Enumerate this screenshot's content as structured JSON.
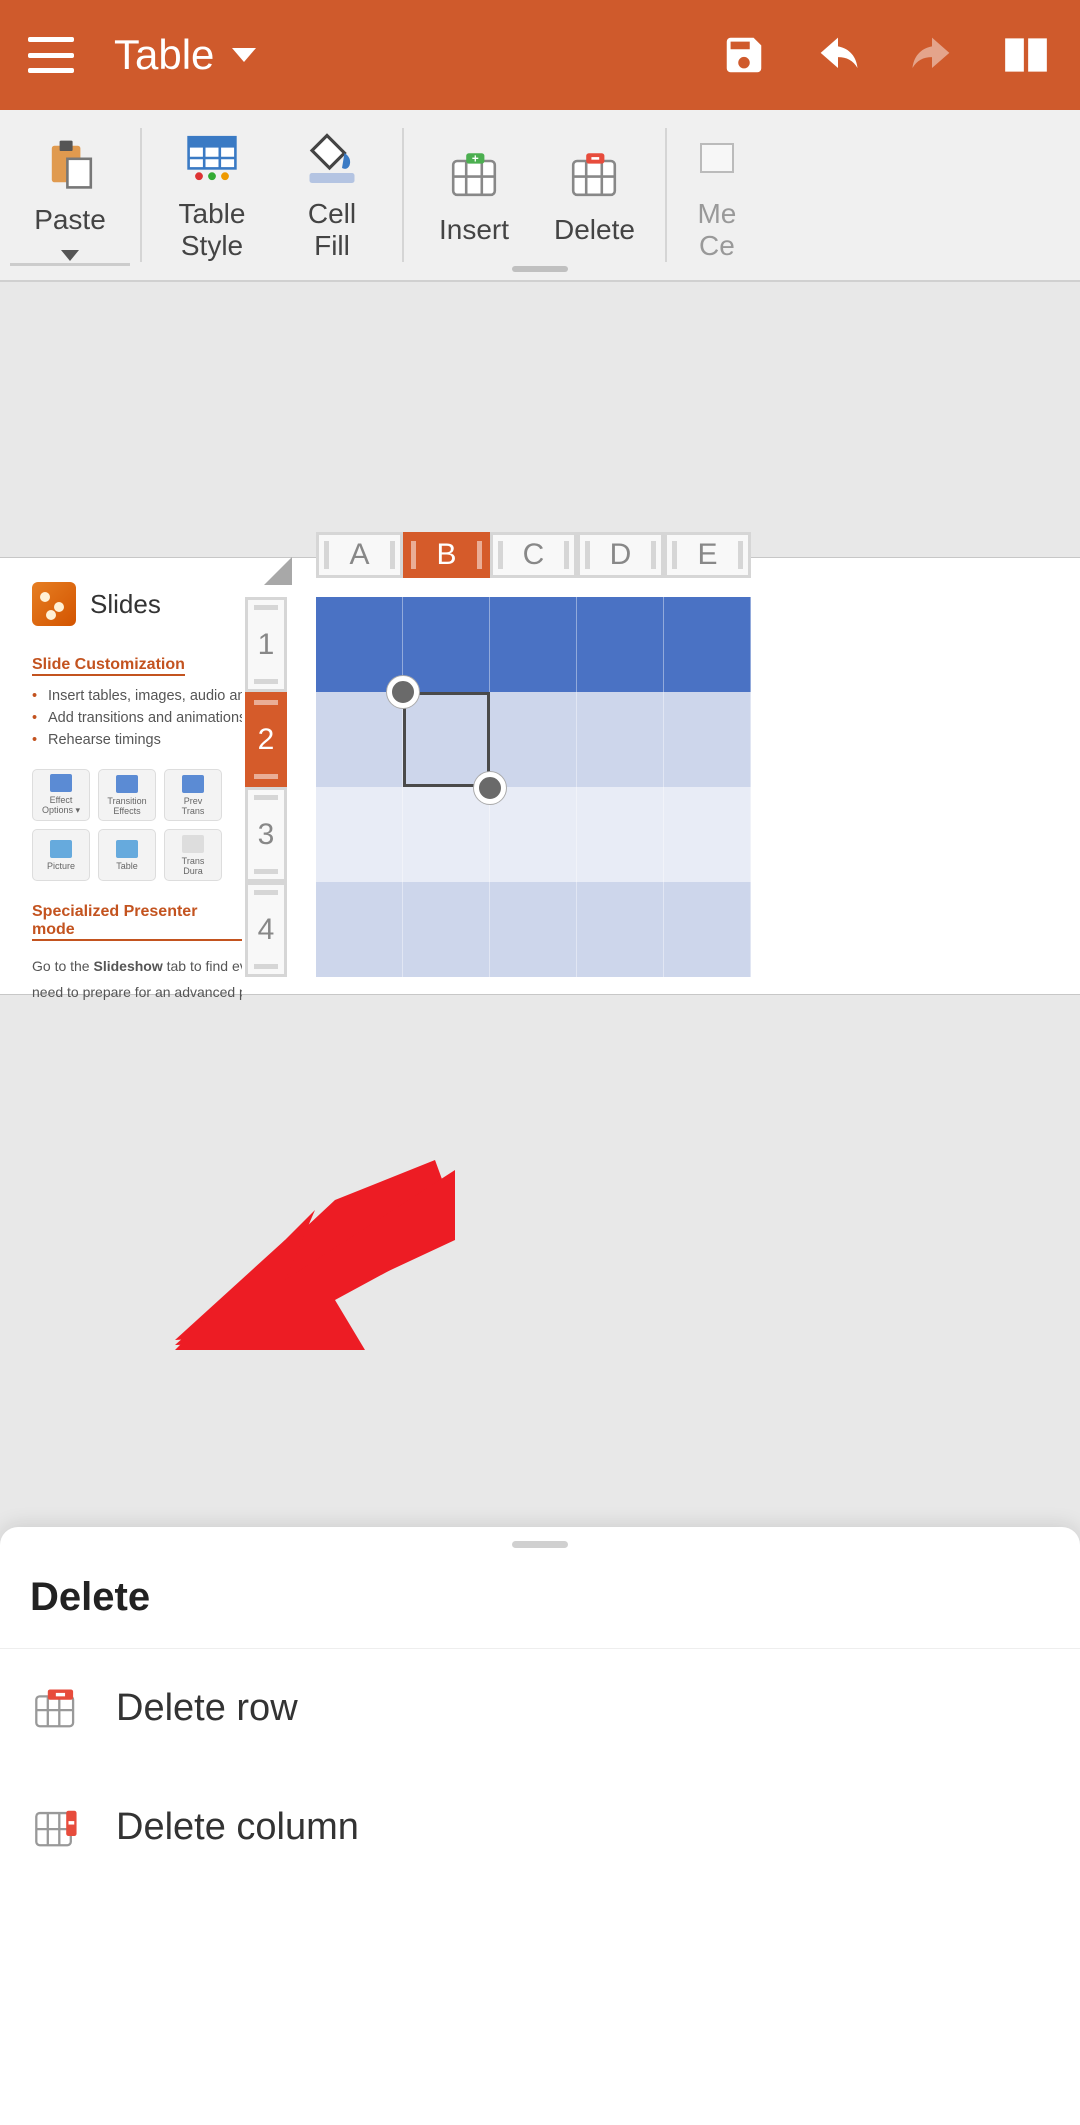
{
  "appbar": {
    "title": "Table",
    "menu_icon": "menu-icon",
    "save_icon": "save-icon",
    "undo_icon": "undo-icon",
    "redo_icon": "redo-icon",
    "read_icon": "book-icon"
  },
  "ribbon": {
    "buttons": [
      {
        "id": "paste",
        "label": "Paste",
        "has_dropdown": true
      },
      {
        "id": "table-style",
        "label": "Table\nStyle"
      },
      {
        "id": "cell-fill",
        "label": "Cell\nFill"
      },
      {
        "id": "insert",
        "label": "Insert"
      },
      {
        "id": "delete",
        "label": "Delete"
      },
      {
        "id": "merge-cells",
        "label": "Me\nCe"
      }
    ]
  },
  "columns": [
    "A",
    "B",
    "C",
    "D",
    "E"
  ],
  "active_column_index": 1,
  "rows": [
    "1",
    "2",
    "3",
    "4"
  ],
  "active_row_index": 1,
  "selection": {
    "row": 2,
    "col": "B"
  },
  "left_pane": {
    "title": "Slides",
    "section1": "Slide Customization",
    "bullets": [
      "Insert tables, images, audio and v",
      "Add transitions and animations",
      "Rehearse timings"
    ],
    "mini_row1": [
      "Effect\nOptions ▾",
      "Transition\nEffects",
      "Prev\nTrans"
    ],
    "mini_row2": [
      "Picture",
      "Table",
      "Trans\nDura"
    ],
    "section2": "Specialized Presenter mode",
    "para_prefix": "Go to the ",
    "para_bold": "Slideshow",
    "para_suffix": " tab to find every",
    "para_line2": "need to prepare for an advanced pre"
  },
  "sheet": {
    "title": "Delete",
    "items": [
      {
        "id": "delete-row",
        "label": "Delete row",
        "icon": "delete-row-icon"
      },
      {
        "id": "delete-column",
        "label": "Delete column",
        "icon": "delete-column-icon"
      }
    ]
  }
}
